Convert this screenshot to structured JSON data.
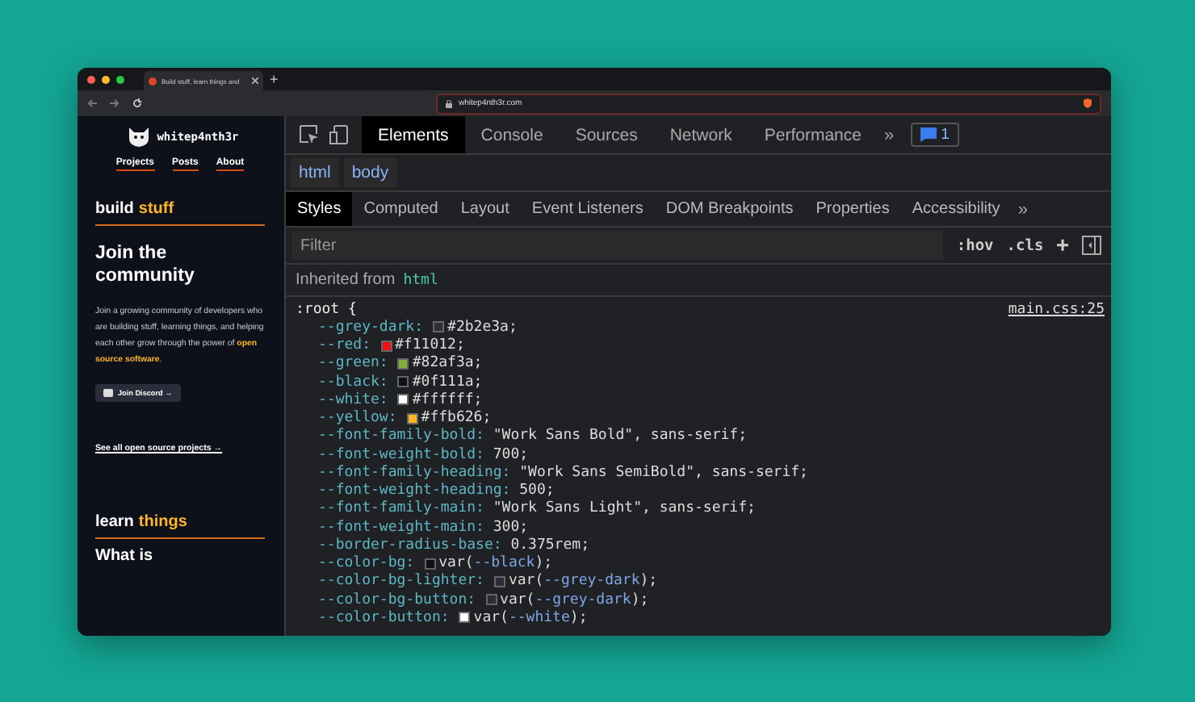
{
  "browser": {
    "tab_title": "Build stuff, learn things and",
    "new_tab": "+",
    "url": "whitep4nth3r.com"
  },
  "site": {
    "logo_text": "whitep4nth3r",
    "nav": [
      {
        "label": "Projects"
      },
      {
        "label": "Posts"
      },
      {
        "label": "About"
      }
    ],
    "section_1": {
      "word": "build",
      "accent": "stuff"
    },
    "title": "Join the community",
    "paragraph": "Join a growing community of developers who are building stuff, learning things, and helping each other grow through the power of **open source software**.",
    "discord_button": "Join Discord →",
    "projects_link": "See all open source projects →",
    "section_2": {
      "word": "learn",
      "accent": "things"
    },
    "next_heading": "What is"
  },
  "devtools": {
    "tabs": [
      {
        "label": "Elements",
        "selected": true
      },
      {
        "label": "Console",
        "selected": false
      },
      {
        "label": "Sources",
        "selected": false
      },
      {
        "label": "Network",
        "selected": false
      },
      {
        "label": "Performance",
        "selected": false
      }
    ],
    "more": "»",
    "issues_count": "1",
    "breadcrumbs": [
      {
        "label": "html"
      },
      {
        "label": "body"
      }
    ],
    "subtabs": [
      {
        "label": "Styles",
        "selected": true
      },
      {
        "label": "Computed",
        "selected": false
      },
      {
        "label": "Layout",
        "selected": false
      },
      {
        "label": "Event Listeners",
        "selected": false
      },
      {
        "label": "DOM Breakpoints",
        "selected": false
      },
      {
        "label": "Properties",
        "selected": false
      },
      {
        "label": "Accessibility",
        "selected": false
      }
    ],
    "subtabs_more": "»",
    "filter": {
      "placeholder": "Filter",
      "hov": ":hov",
      "cls": ".cls",
      "add": "+"
    },
    "inherited": {
      "label": "Inherited from",
      "element": "html"
    },
    "rule": {
      "selector": ":root {",
      "source": "main.css:25",
      "declarations": [
        {
          "name": "--grey-dark:",
          "color": "#2b2e3a",
          "value": "#2b2e3a;"
        },
        {
          "name": "--red:",
          "color": "#f11012",
          "value": "#f11012;"
        },
        {
          "name": "--green:",
          "color": "#82af3a",
          "value": "#82af3a;"
        },
        {
          "name": "--black:",
          "color": "#0f111a",
          "value": "#0f111a;"
        },
        {
          "name": "--white:",
          "color": "#ffffff",
          "value": "#ffffff;"
        },
        {
          "name": "--yellow:",
          "color": "#ffb626",
          "value": "#ffb626;"
        },
        {
          "name": "--font-family-bold:",
          "value": "\"Work Sans Bold\", sans-serif;"
        },
        {
          "name": "--font-weight-bold:",
          "value": "700;"
        },
        {
          "name": "--font-family-heading:",
          "value": "\"Work Sans SemiBold\", sans-serif;"
        },
        {
          "name": "--font-weight-heading:",
          "value": "500;"
        },
        {
          "name": "--font-family-main:",
          "value": "\"Work Sans Light\", sans-serif;"
        },
        {
          "name": "--font-weight-main:",
          "value": "300;"
        },
        {
          "name": "--border-radius-base:",
          "value": "0.375rem;"
        },
        {
          "name": "--color-bg:",
          "color": "#0f111a",
          "value": "var(",
          "ref": "--black",
          "after": ");"
        },
        {
          "name": "--color-bg-lighter:",
          "color": "#2b2e3a",
          "value": "var(",
          "ref": "--grey-dark",
          "after": ");"
        },
        {
          "name": "--color-bg-button:",
          "color": "#2b2e3a",
          "value": "var(",
          "ref": "--grey-dark",
          "after": ");"
        },
        {
          "name": "--color-button:",
          "color": "#ffffff",
          "value": "var(",
          "ref": "--white",
          "after": ");"
        }
      ]
    }
  }
}
